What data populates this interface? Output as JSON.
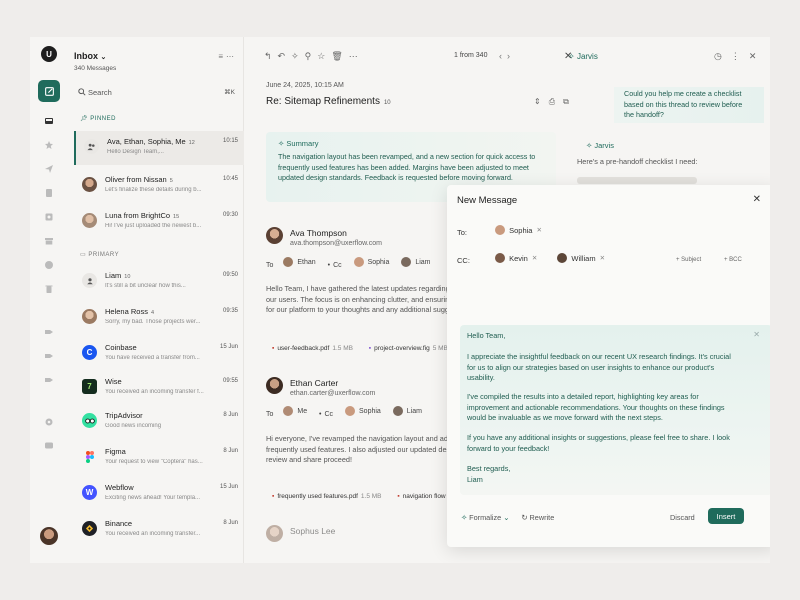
{
  "rail": {
    "user_initial": "U"
  },
  "list": {
    "title": "Inbox",
    "count": "340 Messages",
    "search_label": "Search",
    "search_shortcut": "⌘K",
    "pinned_label": "PINNED",
    "primary_label": "PRIMARY",
    "pinned": [
      {
        "from": "Ava, Ethan, Sophia, Me",
        "count": "12",
        "time": "10:15",
        "preview": "Hello Design Team,..."
      },
      {
        "from": "Oliver from Nissan",
        "count": "5",
        "time": "10:45",
        "preview": "Let's finalize these details during b..."
      },
      {
        "from": "Luna from BrightCo",
        "count": "15",
        "time": "09:30",
        "preview": "Hi! I've just uploaded the newest b..."
      }
    ],
    "primary": [
      {
        "from": "Liam",
        "count": "10",
        "time": "09:50",
        "preview": "It's still a bit unclear how this..."
      },
      {
        "from": "Helena Ross",
        "count": "4",
        "time": "09:35",
        "preview": "Sorry, my bad. Those projects wer..."
      },
      {
        "from": "Coinbase",
        "count": "",
        "time": "15 Jun",
        "preview": "You have received a transfer from..."
      },
      {
        "from": "Wise",
        "count": "",
        "time": "09:55",
        "preview": "You received an incoming transfer f..."
      },
      {
        "from": "TripAdvisor",
        "count": "",
        "time": "8 Jun",
        "preview": "Good news incoming"
      },
      {
        "from": "Figma",
        "count": "",
        "time": "8 Jun",
        "preview": "Your request to view \"Coptera\" has..."
      },
      {
        "from": "Webflow",
        "count": "",
        "time": "15 Jun",
        "preview": "Exciting news ahead! Your templa..."
      },
      {
        "from": "Binance",
        "count": "",
        "time": "8 Jun",
        "preview": "You received an incoming transfer..."
      }
    ]
  },
  "main": {
    "pager": "1 from 340",
    "date": "June 24, 2025, 10:15 AM",
    "subject": "Re: Sitemap Refinements",
    "subject_count": "10",
    "summary_title": "Summary",
    "summary_text": "The navigation layout has been revamped, and a new section for quick access to frequently used features has been added. Margins have been adjusted to meet updated design standards. Feedback is requested before moving forward.",
    "messages": [
      {
        "name": "Ava Thompson",
        "email": "ava.thompson@uxerflow.com",
        "to_label": "To",
        "to": [
          "Ethan",
          "Cc",
          "Sophia",
          "Liam"
        ],
        "body": "Hello Team, I have gathered the latest updates regarding the recent feedback from our users. The focus is on enhancing clutter, and ensuring a seamless experience for our platform to your thoughts and any additional suggestions for improvement",
        "attachments": [
          {
            "kind": "pdf",
            "name": "user-feedback.pdf",
            "size": "1.5 MB"
          },
          {
            "kind": "fig",
            "name": "project-overview.fig",
            "size": "5 MB"
          }
        ]
      },
      {
        "name": "Ethan Carter",
        "email": "ethan.carter@uxerflow.com",
        "to_label": "To",
        "to": [
          "Me",
          "Cc",
          "Sophia",
          "Liam"
        ],
        "body": "Hi everyone, I've revamped the navigation layout and added quick access to frequently used features. I also adjusted our updated design standards. Please review and share proceed!",
        "attachments": [
          {
            "kind": "pdf",
            "name": "frequently used features.pdf",
            "size": "1.5 MB"
          },
          {
            "kind": "pdf",
            "name": "navigation flow",
            "size": ""
          }
        ]
      }
    ],
    "next_sender": "Sophus Lee"
  },
  "jarvis": {
    "title": "Jarvis",
    "question": "Could you help me create a checklist based on this thread to review before the handoff?",
    "answer_title": "Jarvis",
    "answer_intro": "Here's a pre-handoff checklist I need:"
  },
  "compose": {
    "title": "New Message",
    "to_label": "To:",
    "to": [
      "Sophia"
    ],
    "cc_label": "CC:",
    "cc": [
      "Kevin",
      "William"
    ],
    "subject_btn": "Subject",
    "bcc_btn": "BCC",
    "greeting": "Hello Team,",
    "p1": "I appreciate the insightful feedback on our recent UX research findings. It's crucial for us to align our strategies based on user insights to enhance our product's usability.",
    "p2": "I've compiled the results into a detailed report, highlighting key areas for improvement and actionable recommendations. Your thoughts on these findings would be invaluable as we move forward with the next steps.",
    "p3": "If you have any additional insights or suggestions, please feel free to share. I look forward to your feedback!",
    "signoff": "Best regards,",
    "signature": "Liam",
    "formalize": "Formalize",
    "rewrite": "Rewrite",
    "discard": "Discard",
    "insert": "Insert"
  }
}
